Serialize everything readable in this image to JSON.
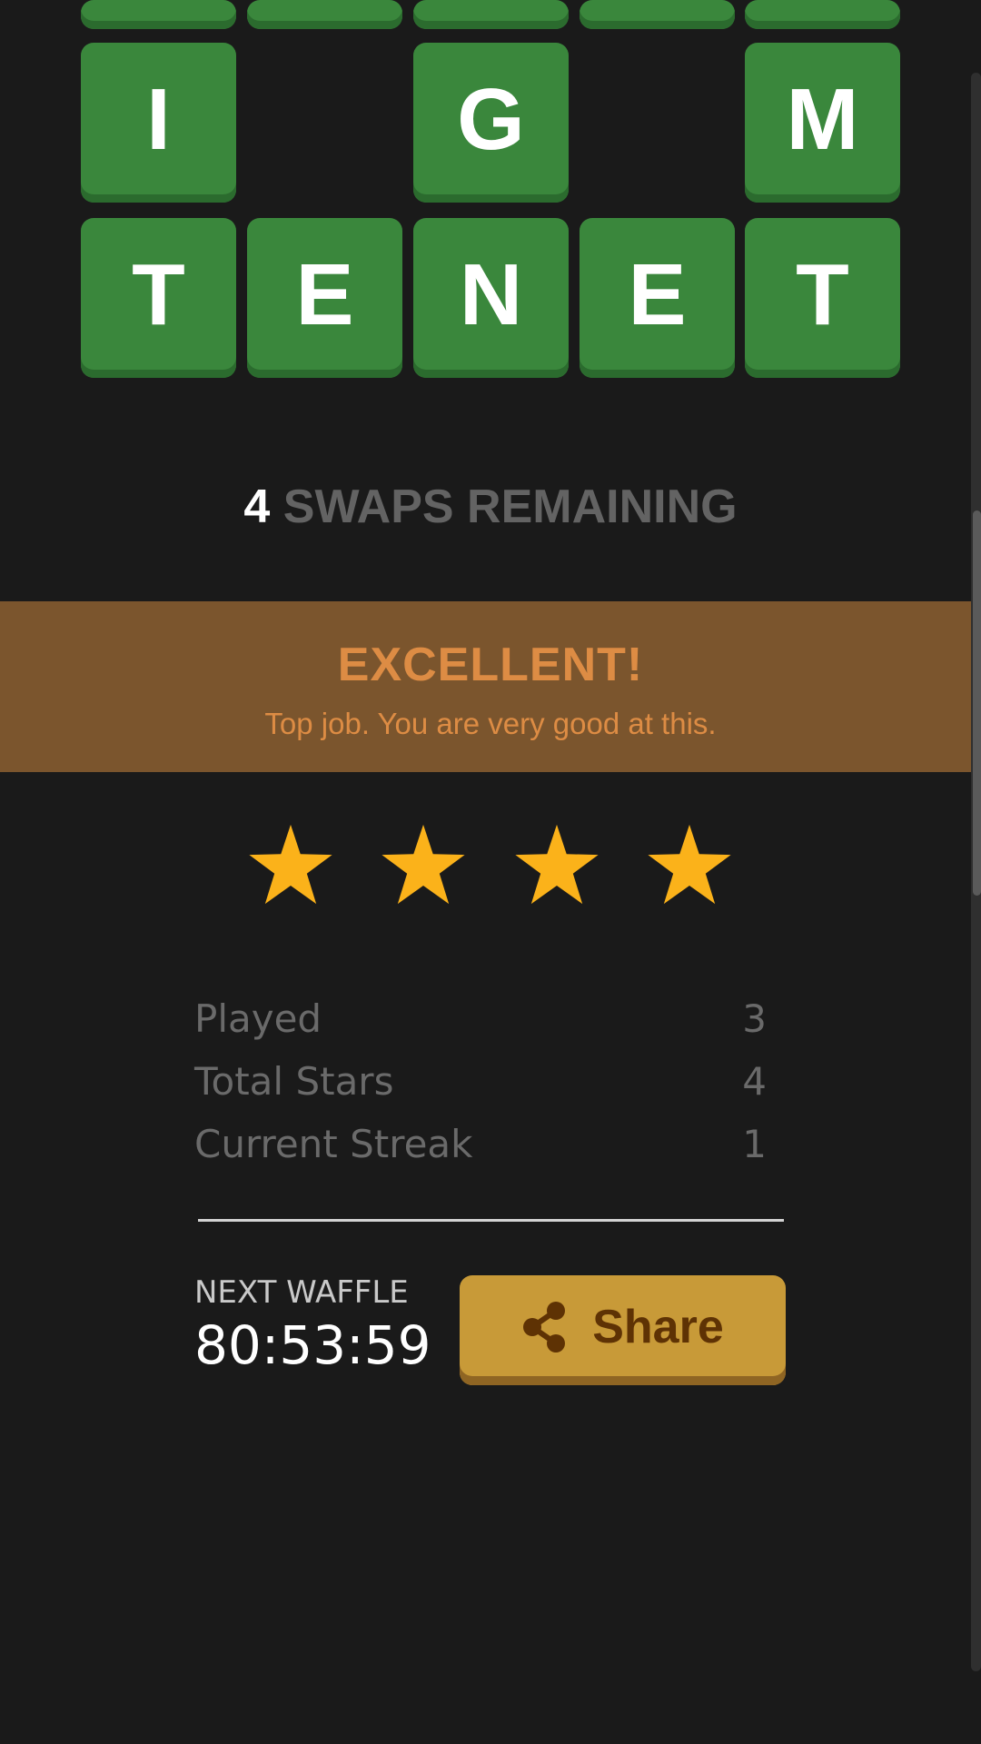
{
  "board": {
    "row_top": [
      "",
      "",
      "",
      "",
      ""
    ],
    "row_middle": [
      "I",
      "G",
      "M"
    ],
    "row_bottom": [
      "T",
      "E",
      "N",
      "E",
      "T"
    ]
  },
  "swaps": {
    "count": "4",
    "label": "SWAPS REMAINING"
  },
  "result": {
    "title": "EXCELLENT!",
    "message": "Top job. You are very good at this."
  },
  "stars": {
    "earned": 4,
    "color": "#fbb21a"
  },
  "stats": [
    {
      "label": "Played",
      "value": "3"
    },
    {
      "label": "Total Stars",
      "value": "4"
    },
    {
      "label": "Current Streak",
      "value": "1"
    }
  ],
  "next": {
    "label": "NEXT WAFFLE",
    "timer": "80:53:59"
  },
  "share": {
    "label": "Share",
    "icon": "share-icon"
  },
  "colors": {
    "background": "#1a1a1a",
    "tile_green": "#3a873c",
    "banner": "#7b552d",
    "banner_text": "#dd8c44",
    "share_button": "#c89a38",
    "share_text": "#5e3204"
  }
}
